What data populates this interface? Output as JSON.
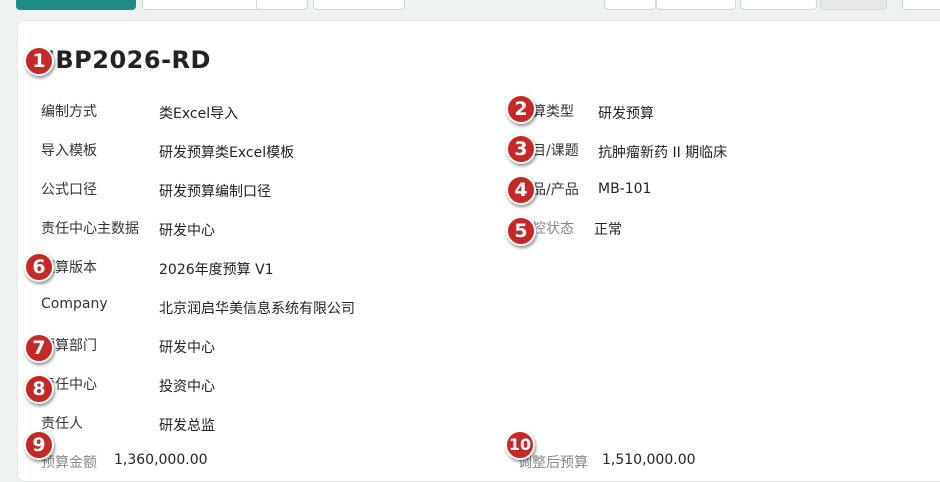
{
  "title": "MBP2026-RD",
  "fields_left": [
    {
      "label": "编制方式",
      "value": "类Excel导入"
    },
    {
      "label": "导入模板",
      "value": "研发预算类Excel模板"
    },
    {
      "label": "公式口径",
      "value": "研发预算编制口径"
    },
    {
      "label": "责任中心主数据",
      "value": "研发中心"
    },
    {
      "label": "预算版本",
      "value": "2026年度预算 V1"
    },
    {
      "label": "Company",
      "value": "北京润启华美信息系统有限公司"
    },
    {
      "label": "预算部门",
      "value": "研发中心"
    },
    {
      "label": "责任中心",
      "value": "投资中心"
    },
    {
      "label": "责任人",
      "value": "研发总监"
    }
  ],
  "fields_right": [
    {
      "label": "预算类型",
      "value": "研发预算"
    },
    {
      "label": "项目/课题",
      "value": "抗肿瘤新药 II 期临床"
    },
    {
      "label": "产品/产品",
      "value": "MB-101"
    },
    {
      "label": "管控状态",
      "value": "正常"
    }
  ],
  "amount": {
    "label": "预算金额",
    "value": "1,360,000.00"
  },
  "adjusted": {
    "label": "调整后预算",
    "value": "1,510,000.00"
  },
  "badges": [
    "1",
    "2",
    "3",
    "4",
    "5",
    "6",
    "7",
    "8",
    "9",
    "10"
  ]
}
